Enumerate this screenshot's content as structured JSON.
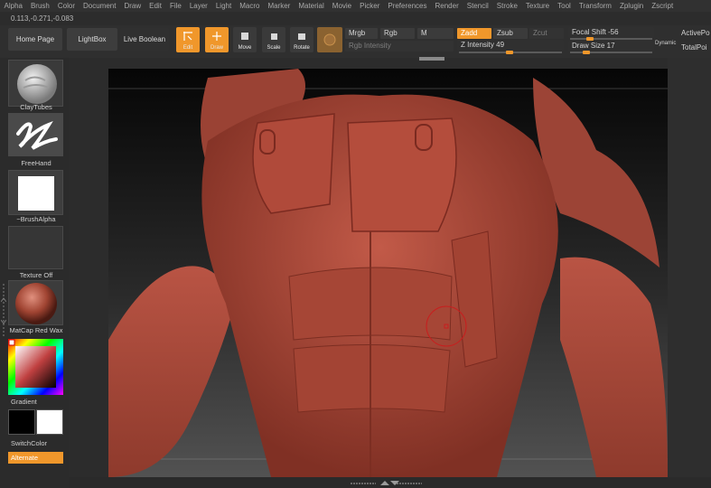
{
  "menu": [
    "Alpha",
    "Brush",
    "Color",
    "Document",
    "Draw",
    "Edit",
    "File",
    "Layer",
    "Light",
    "Macro",
    "Marker",
    "Material",
    "Movie",
    "Picker",
    "Preferences",
    "Render",
    "Stencil",
    "Stroke",
    "Texture",
    "Tool",
    "Transform",
    "Zplugin",
    "Zscript"
  ],
  "coords": "0.113,-0.271,-0.083",
  "toolbar": {
    "home_page": "Home Page",
    "lightbox": "LightBox",
    "live_boolean": "Live Boolean",
    "edit": "Edit",
    "draw": "Draw",
    "move": "Move",
    "scale": "Scale",
    "rotate": "Rotate",
    "mrgb": "Mrgb",
    "rgb": "Rgb",
    "m": "M",
    "rgb_intensity": "Rgb Intensity",
    "zadd": "Zadd",
    "zsub": "Zsub",
    "zcut": "Zcut",
    "z_intensity": "Z Intensity 49",
    "focal_shift": "Focal Shift -56",
    "draw_size": "Draw Size 17",
    "dynamic": "Dynamic",
    "active_points": "ActivePo",
    "total_points": "TotalPoi"
  },
  "sliders": {
    "z_intensity": 0.49,
    "focal_shift": -0.56,
    "draw_size": 0.17
  },
  "leftpanel": {
    "brush": "ClayTubes",
    "stroke": "FreeHand",
    "alpha": "~BrushAlpha",
    "texture": "Texture Off",
    "material": "MatCap Red Wax",
    "gradient": "Gradient",
    "switch_color": "SwitchColor",
    "alternate": "Alternate"
  },
  "colors": {
    "accent": "#f0972b",
    "model": "#b04a3a",
    "background": "#2c2c2c"
  }
}
